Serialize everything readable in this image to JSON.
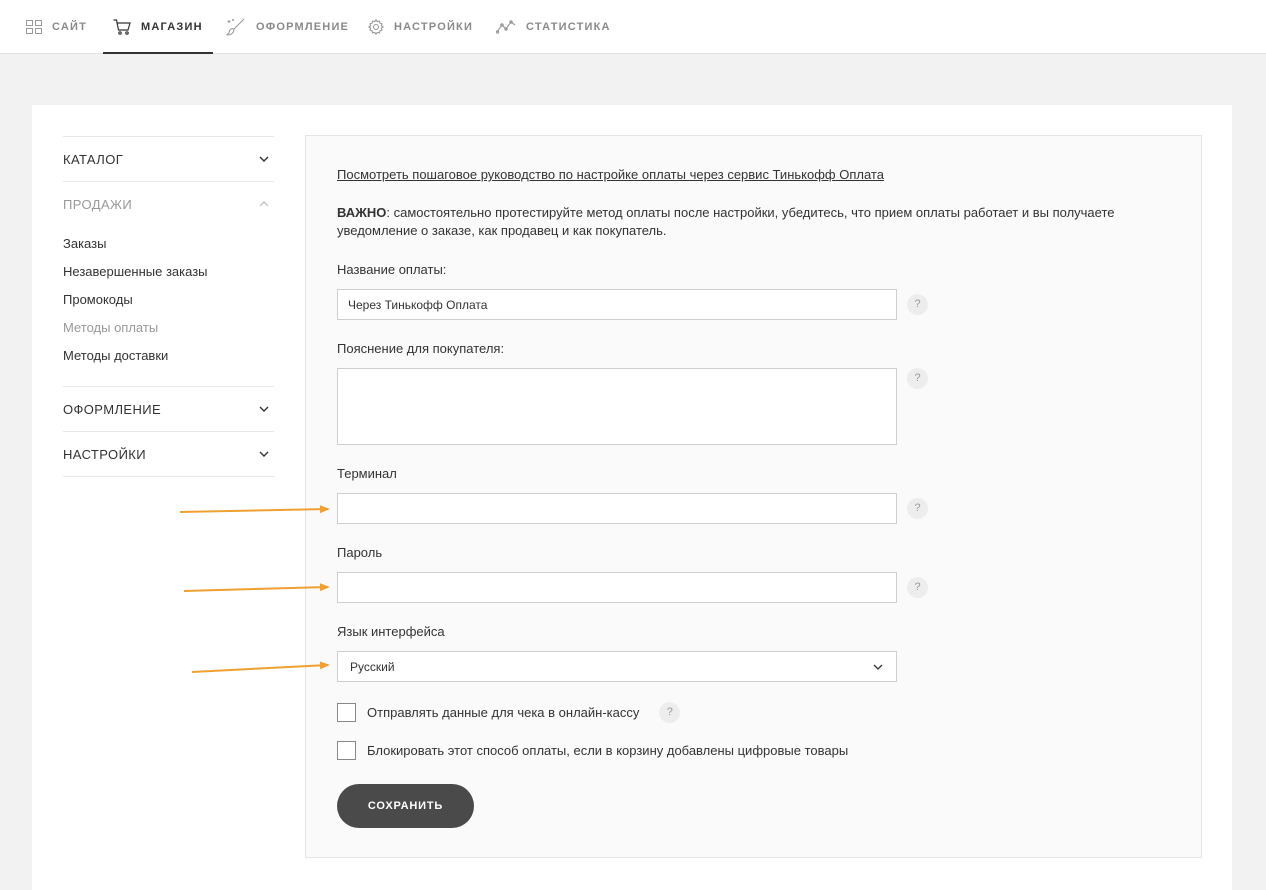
{
  "nav": {
    "tabs": [
      {
        "label": "САЙТ",
        "icon": "grid-icon"
      },
      {
        "label": "МАГАЗИН",
        "icon": "cart-icon",
        "active": true
      },
      {
        "label": "ОФОРМЛЕНИЕ",
        "icon": "brush-icon"
      },
      {
        "label": "НАСТРОЙКИ",
        "icon": "gear-icon"
      },
      {
        "label": "СТАТИСТИКА",
        "icon": "chart-line-icon"
      }
    ]
  },
  "sidebar": {
    "catalog": "КАТАЛОГ",
    "sales": "ПРОДАЖИ",
    "sales_items": [
      "Заказы",
      "Незавершенные заказы",
      "Промокоды",
      "Методы оплаты",
      "Методы доставки"
    ],
    "design": "ОФОРМЛЕНИЕ",
    "settings": "НАСТРОЙКИ"
  },
  "form": {
    "guide_link": "Посмотреть пошаговое руководство по настройке оплаты через сервис Тинькофф Оплата",
    "important_bold": "ВАЖНО",
    "important_text": ": самостоятельно протестируйте метод оплаты после настройки, убедитесь, что прием оплаты работает и вы получаете уведомление о заказе, как продавец и как покупатель.",
    "payment_name_label": "Название оплаты:",
    "payment_name_value": "Через Тинькофф Оплата",
    "buyer_note_label": "Пояснение для покупателя:",
    "buyer_note_value": "",
    "terminal_label": "Терминал",
    "terminal_value": "",
    "password_label": "Пароль",
    "password_value": "",
    "language_label": "Язык интерфейса",
    "language_value": "Русский",
    "help_glyph": "?",
    "checkbox_receipt": "Отправлять данные для чека в онлайн-кассу",
    "checkbox_block_digital": "Блокировать этот способ оплаты, если в корзину добавлены цифровые товары",
    "save_label": "СОХРАНИТЬ"
  },
  "colors": {
    "annotation_arrow": "#f0a030",
    "save_button": "#4a4a4a",
    "page_background": "#f2f2f2"
  }
}
